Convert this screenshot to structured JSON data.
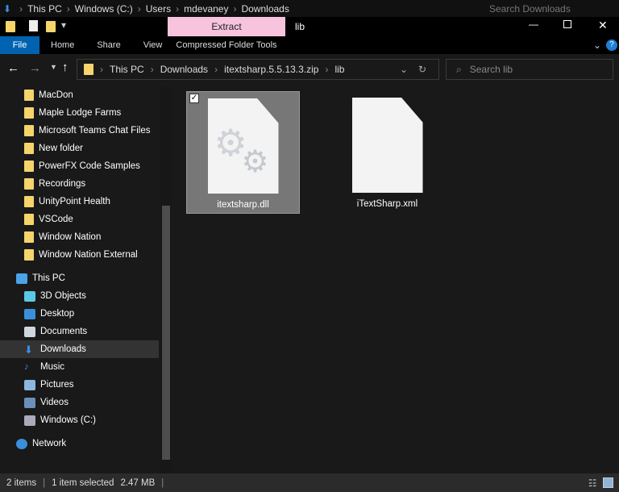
{
  "background_window": {
    "breadcrumb": [
      "This PC",
      "Windows (C:)",
      "Users",
      "mdevaney",
      "Downloads"
    ],
    "search_placeholder": "Search Downloads"
  },
  "title_bar": {
    "context_tab": "Extract",
    "title": "lib"
  },
  "ribbon": {
    "tabs": [
      "File",
      "Home",
      "Share",
      "View",
      "Compressed Folder Tools"
    ]
  },
  "address": {
    "path": [
      "This PC",
      "Downloads",
      "itextsharp.5.5.13.3.zip",
      "lib"
    ],
    "search_placeholder": "Search lib"
  },
  "nav": {
    "quick": [
      "MacDon",
      "Maple Lodge Farms",
      "Microsoft Teams Chat Files",
      "New folder",
      "PowerFX Code Samples",
      "Recordings",
      "UnityPoint Health",
      "VSCode",
      "Window Nation",
      "Window Nation External"
    ],
    "this_pc": "This PC",
    "pc_items": [
      "3D Objects",
      "Desktop",
      "Documents",
      "Downloads",
      "Music",
      "Pictures",
      "Videos",
      "Windows (C:)"
    ],
    "network": "Network"
  },
  "files": [
    {
      "name": "itextsharp.dll",
      "selected": true
    },
    {
      "name": "iTextSharp.xml",
      "selected": false
    }
  ],
  "status": {
    "count": "2 items",
    "selected": "1 item selected",
    "size": "2.47 MB"
  }
}
